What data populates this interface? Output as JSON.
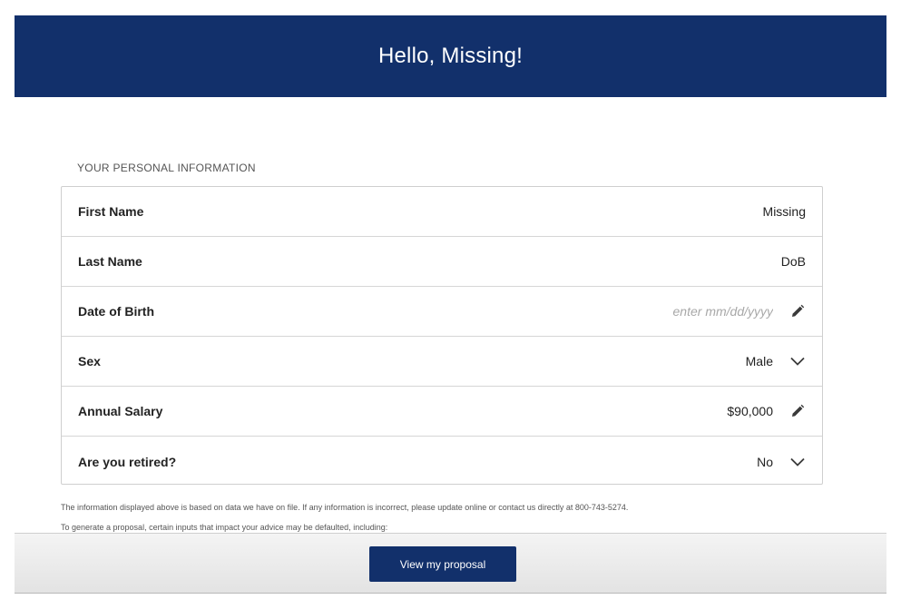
{
  "header": {
    "title": "Hello, Missing!"
  },
  "section": {
    "title": "YOUR PERSONAL INFORMATION"
  },
  "fields": {
    "first_name": {
      "label": "First Name",
      "value": "Missing"
    },
    "last_name": {
      "label": "Last Name",
      "value": "DoB"
    },
    "dob": {
      "label": "Date of Birth",
      "value": "",
      "placeholder": "enter mm/dd/yyyy",
      "icon": "pencil-icon"
    },
    "sex": {
      "label": "Sex",
      "value": "Male",
      "icon": "chevron-down-icon"
    },
    "salary": {
      "label": "Annual Salary",
      "value": "$90,000",
      "icon": "pencil-icon"
    },
    "retired": {
      "label": "Are you retired?",
      "value": "No",
      "icon": "chevron-down-icon"
    }
  },
  "disclaimer": {
    "line1": "The information displayed above is based on data we have on file. If any information is incorrect, please update online or contact us directly at 800-743-5274.",
    "line2": "To generate a proposal, certain inputs that impact your advice may be defaulted, including:"
  },
  "footer": {
    "button_label": "View my proposal"
  },
  "colors": {
    "brand_navy": "#12306b",
    "border": "#cfcfcf"
  }
}
